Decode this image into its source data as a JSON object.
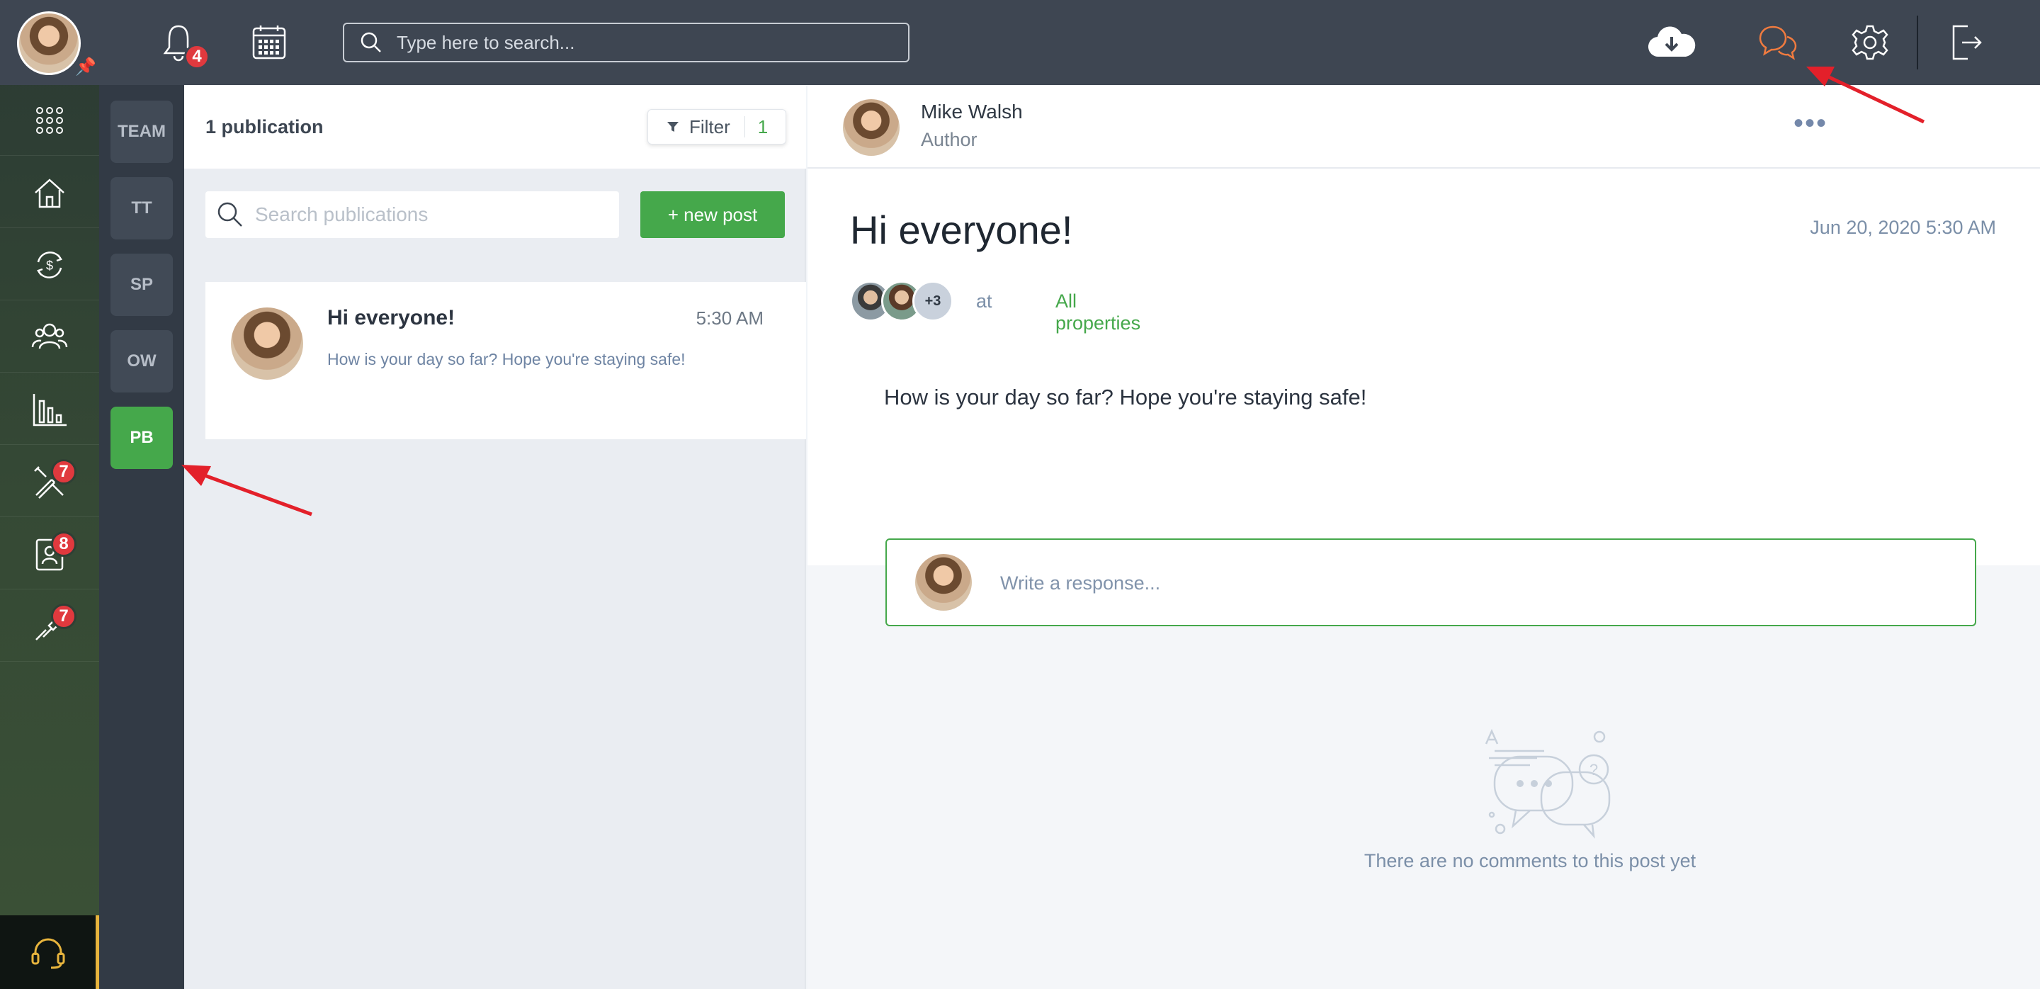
{
  "topbar": {
    "notifications_count": "4",
    "search_placeholder": "Type here to search...",
    "icons": [
      "bell-icon",
      "calendar-icon",
      "search-icon",
      "cloud-download-icon",
      "chat-icon",
      "gear-icon",
      "logout-icon"
    ]
  },
  "rail": {
    "items": [
      {
        "name": "apps-icon",
        "badge": ""
      },
      {
        "name": "home-icon",
        "badge": ""
      },
      {
        "name": "finance-icon",
        "badge": ""
      },
      {
        "name": "people-icon",
        "badge": ""
      },
      {
        "name": "reports-icon",
        "badge": ""
      },
      {
        "name": "maintenance-icon",
        "badge": "7"
      },
      {
        "name": "tenant-icon",
        "badge": "8"
      },
      {
        "name": "tools-icon",
        "badge": "7"
      }
    ],
    "badges": {
      "maintenance": "7",
      "tenant": "8",
      "tools": "7"
    }
  },
  "groups": [
    "TEAM",
    "TT",
    "SP",
    "OW",
    "PB"
  ],
  "list": {
    "count_label": "1 publication",
    "filter_label": "Filter",
    "filter_count": "1",
    "search_placeholder": "Search publications",
    "new_post_label": "+ new post",
    "post": {
      "title": "Hi everyone!",
      "time": "5:30 AM",
      "snippet": "How is your day so far? Hope you're staying safe!"
    }
  },
  "detail": {
    "author_name": "Mike Walsh",
    "author_role": "Author",
    "more_label": "•••",
    "title": "Hi everyone!",
    "date": "Jun 20, 2020 5:30 AM",
    "audience_more": "+3",
    "at_label": "at",
    "location": "All properties",
    "body": "How is your day so far? Hope you're staying safe!",
    "response_placeholder": "Write a response...",
    "empty_text": "There are no comments to this post yet"
  },
  "colors": {
    "topbar": "#3e4652",
    "accent_green": "#45a84b",
    "badge_red": "#e0393e",
    "chat_orange": "#f07b3f",
    "arrow_red": "#e3202a"
  }
}
